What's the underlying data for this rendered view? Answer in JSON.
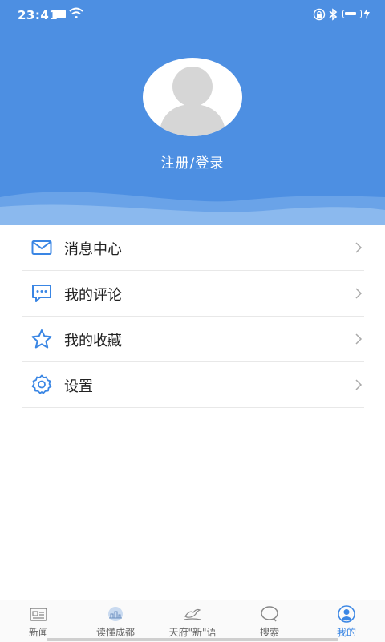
{
  "status_bar": {
    "time": "23:41"
  },
  "profile": {
    "login_text": "注册/登录"
  },
  "menu": {
    "items": [
      {
        "label": "消息中心",
        "icon": "mail-icon"
      },
      {
        "label": "我的评论",
        "icon": "comment-icon"
      },
      {
        "label": "我的收藏",
        "icon": "star-icon"
      },
      {
        "label": "设置",
        "icon": "gear-icon"
      }
    ]
  },
  "tabbar": {
    "tabs": [
      {
        "label": "新闻",
        "icon": "news-icon"
      },
      {
        "label": "读懂成都",
        "icon": "city-icon"
      },
      {
        "label": "天府\"新\"语",
        "icon": "bird-icon"
      },
      {
        "label": "搜索",
        "icon": "search-icon"
      },
      {
        "label": "我的",
        "icon": "user-icon"
      }
    ],
    "active_index": 4
  },
  "colors": {
    "primary": "#4d8fe2",
    "accent": "#3a86e4"
  }
}
